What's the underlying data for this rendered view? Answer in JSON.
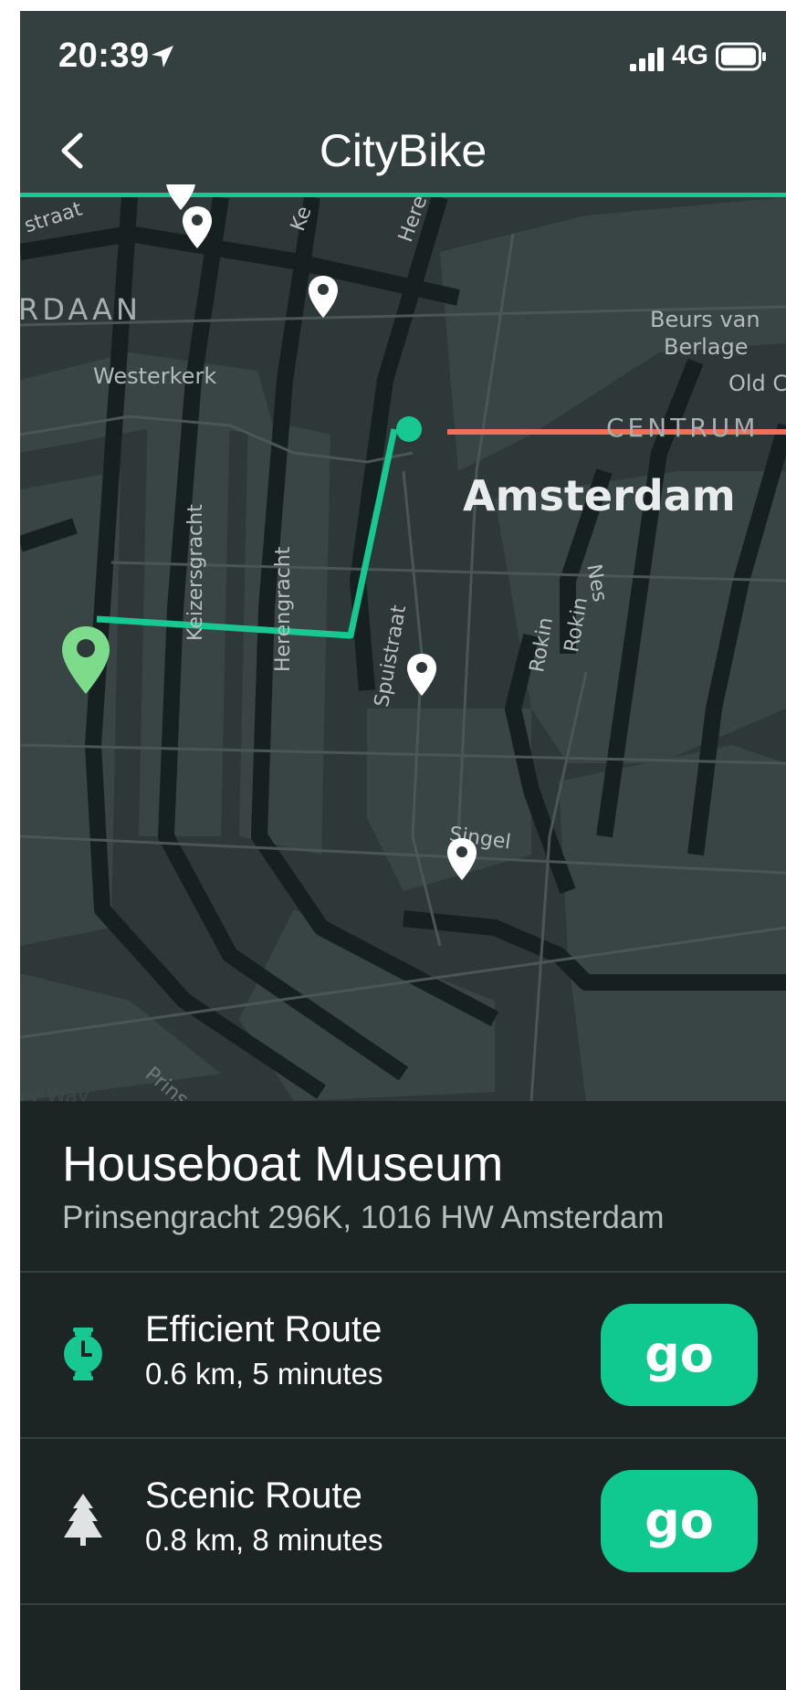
{
  "status_bar": {
    "time": "20:39",
    "location_icon": "location-arrow-icon",
    "signal_icon": "cellular-signal-icon",
    "network": "4G",
    "battery_icon": "battery-full-icon"
  },
  "nav": {
    "back_icon": "chevron-left-icon",
    "title": "CityBike",
    "accent_color": "#17c893"
  },
  "map": {
    "labels": {
      "straat": "straat",
      "jordaan": "RDAAN",
      "westerkerk": "Westerkerk",
      "beurs": "Beurs van",
      "berlage": "Berlage",
      "old_church": "Old Cl",
      "centrum": "CENTRUM",
      "amsterdam": "Amsterdam",
      "keizersgracht": "Keizersgracht",
      "herengracht": "Herengracht",
      "spuistraat": "Spuistraat",
      "rokin_top": "Rokin",
      "rokin_bottom": "Rokin",
      "nes": "Nes",
      "singel": "Singel",
      "ke": "Ke",
      "here": "Here",
      "prinsen": "Prinsen",
      "ry_way": "ry Way"
    },
    "route_color": "#17c893",
    "alt_route_color": "#f0705a",
    "start_pin_color": "#7ddc8c",
    "pin_icon": "map-pin-icon"
  },
  "destination": {
    "name": "Houseboat Museum",
    "address": "Prinsengracht 296K, 1016 HW Amsterdam"
  },
  "routes": [
    {
      "icon": "stopwatch-icon",
      "name": "Efficient Route",
      "detail": "0.6 km, 5 minutes",
      "button": "go"
    },
    {
      "icon": "tree-icon",
      "name": "Scenic Route",
      "detail": "0.8 km, 8 minutes",
      "button": "go"
    }
  ],
  "colors": {
    "background": "#1c2424",
    "header": "#343f3f",
    "button": "#10c990"
  }
}
